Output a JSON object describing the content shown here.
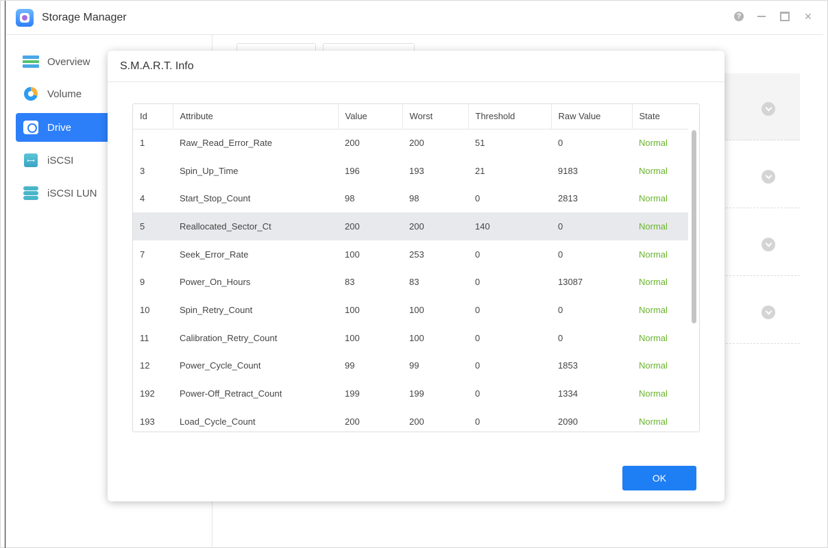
{
  "app": {
    "title": "Storage Manager"
  },
  "window_controls": {
    "help": "?",
    "close": "✕"
  },
  "sidebar": {
    "items": [
      {
        "label": "Overview",
        "active": false
      },
      {
        "label": "Volume",
        "active": false
      },
      {
        "label": "Drive",
        "active": true
      },
      {
        "label": "iSCSI",
        "active": false
      },
      {
        "label": "iSCSI LUN",
        "active": false
      }
    ]
  },
  "dialog": {
    "title": "S.M.A.R.T. Info",
    "ok_label": "OK",
    "columns": [
      "Id",
      "Attribute",
      "Value",
      "Worst",
      "Threshold",
      "Raw Value",
      "State"
    ],
    "rows": [
      {
        "id": "1",
        "attribute": "Raw_Read_Error_Rate",
        "value": "200",
        "worst": "200",
        "threshold": "51",
        "raw": "0",
        "state": "Normal"
      },
      {
        "id": "3",
        "attribute": "Spin_Up_Time",
        "value": "196",
        "worst": "193",
        "threshold": "21",
        "raw": "9183",
        "state": "Normal"
      },
      {
        "id": "4",
        "attribute": "Start_Stop_Count",
        "value": "98",
        "worst": "98",
        "threshold": "0",
        "raw": "2813",
        "state": "Normal"
      },
      {
        "id": "5",
        "attribute": "Reallocated_Sector_Ct",
        "value": "200",
        "worst": "200",
        "threshold": "140",
        "raw": "0",
        "state": "Normal"
      },
      {
        "id": "7",
        "attribute": "Seek_Error_Rate",
        "value": "100",
        "worst": "253",
        "threshold": "0",
        "raw": "0",
        "state": "Normal"
      },
      {
        "id": "9",
        "attribute": "Power_On_Hours",
        "value": "83",
        "worst": "83",
        "threshold": "0",
        "raw": "13087",
        "state": "Normal"
      },
      {
        "id": "10",
        "attribute": "Spin_Retry_Count",
        "value": "100",
        "worst": "100",
        "threshold": "0",
        "raw": "0",
        "state": "Normal"
      },
      {
        "id": "11",
        "attribute": "Calibration_Retry_Count",
        "value": "100",
        "worst": "100",
        "threshold": "0",
        "raw": "0",
        "state": "Normal"
      },
      {
        "id": "12",
        "attribute": "Power_Cycle_Count",
        "value": "99",
        "worst": "99",
        "threshold": "0",
        "raw": "1853",
        "state": "Normal"
      },
      {
        "id": "192",
        "attribute": "Power-Off_Retract_Count",
        "value": "199",
        "worst": "199",
        "threshold": "0",
        "raw": "1334",
        "state": "Normal"
      },
      {
        "id": "193",
        "attribute": "Load_Cycle_Count",
        "value": "200",
        "worst": "200",
        "threshold": "0",
        "raw": "2090",
        "state": "Normal"
      }
    ]
  },
  "colors": {
    "accent": "#1e7ef4",
    "state_normal": "#69b52c",
    "highlight_row": "#e8e9ec"
  }
}
